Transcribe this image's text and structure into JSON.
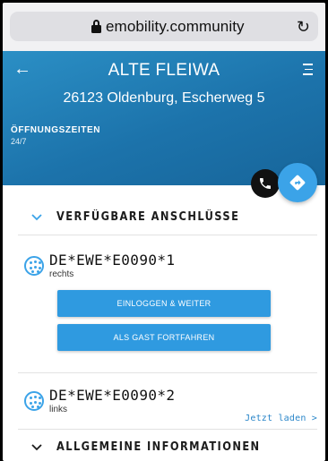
{
  "browser": {
    "url": "emobility.community",
    "lock_icon": "lock-icon",
    "reload_icon": "reload-icon"
  },
  "header": {
    "title": "ALTE FLEIWA",
    "address": "26123 Oldenburg, Escherweg 5",
    "hours_label": "ÖFFNUNGSZEITEN",
    "hours_value": "24/7",
    "back_icon": "arrow-left-icon",
    "menu_icon": "menu-icon",
    "gradient_color": "#1c73ab"
  },
  "actions": {
    "phone_icon": "phone-icon",
    "navigate_icon": "navigate-icon",
    "accent_color": "#3ba3e8"
  },
  "sections": {
    "connectors_title": "VERFÜGBARE ANSCHLÜSSE",
    "general_title": "ALLGEMEINE INFORMATIONEN"
  },
  "connectors": [
    {
      "id": "DE*EWE*E0090*1",
      "side": "rechts",
      "login_label": "EINLOGGEN & WEITER",
      "guest_label": "ALS GAST FORTFAHREN"
    },
    {
      "id": "DE*EWE*E0090*2",
      "side": "links",
      "charge_label": "Jetzt laden >"
    }
  ]
}
